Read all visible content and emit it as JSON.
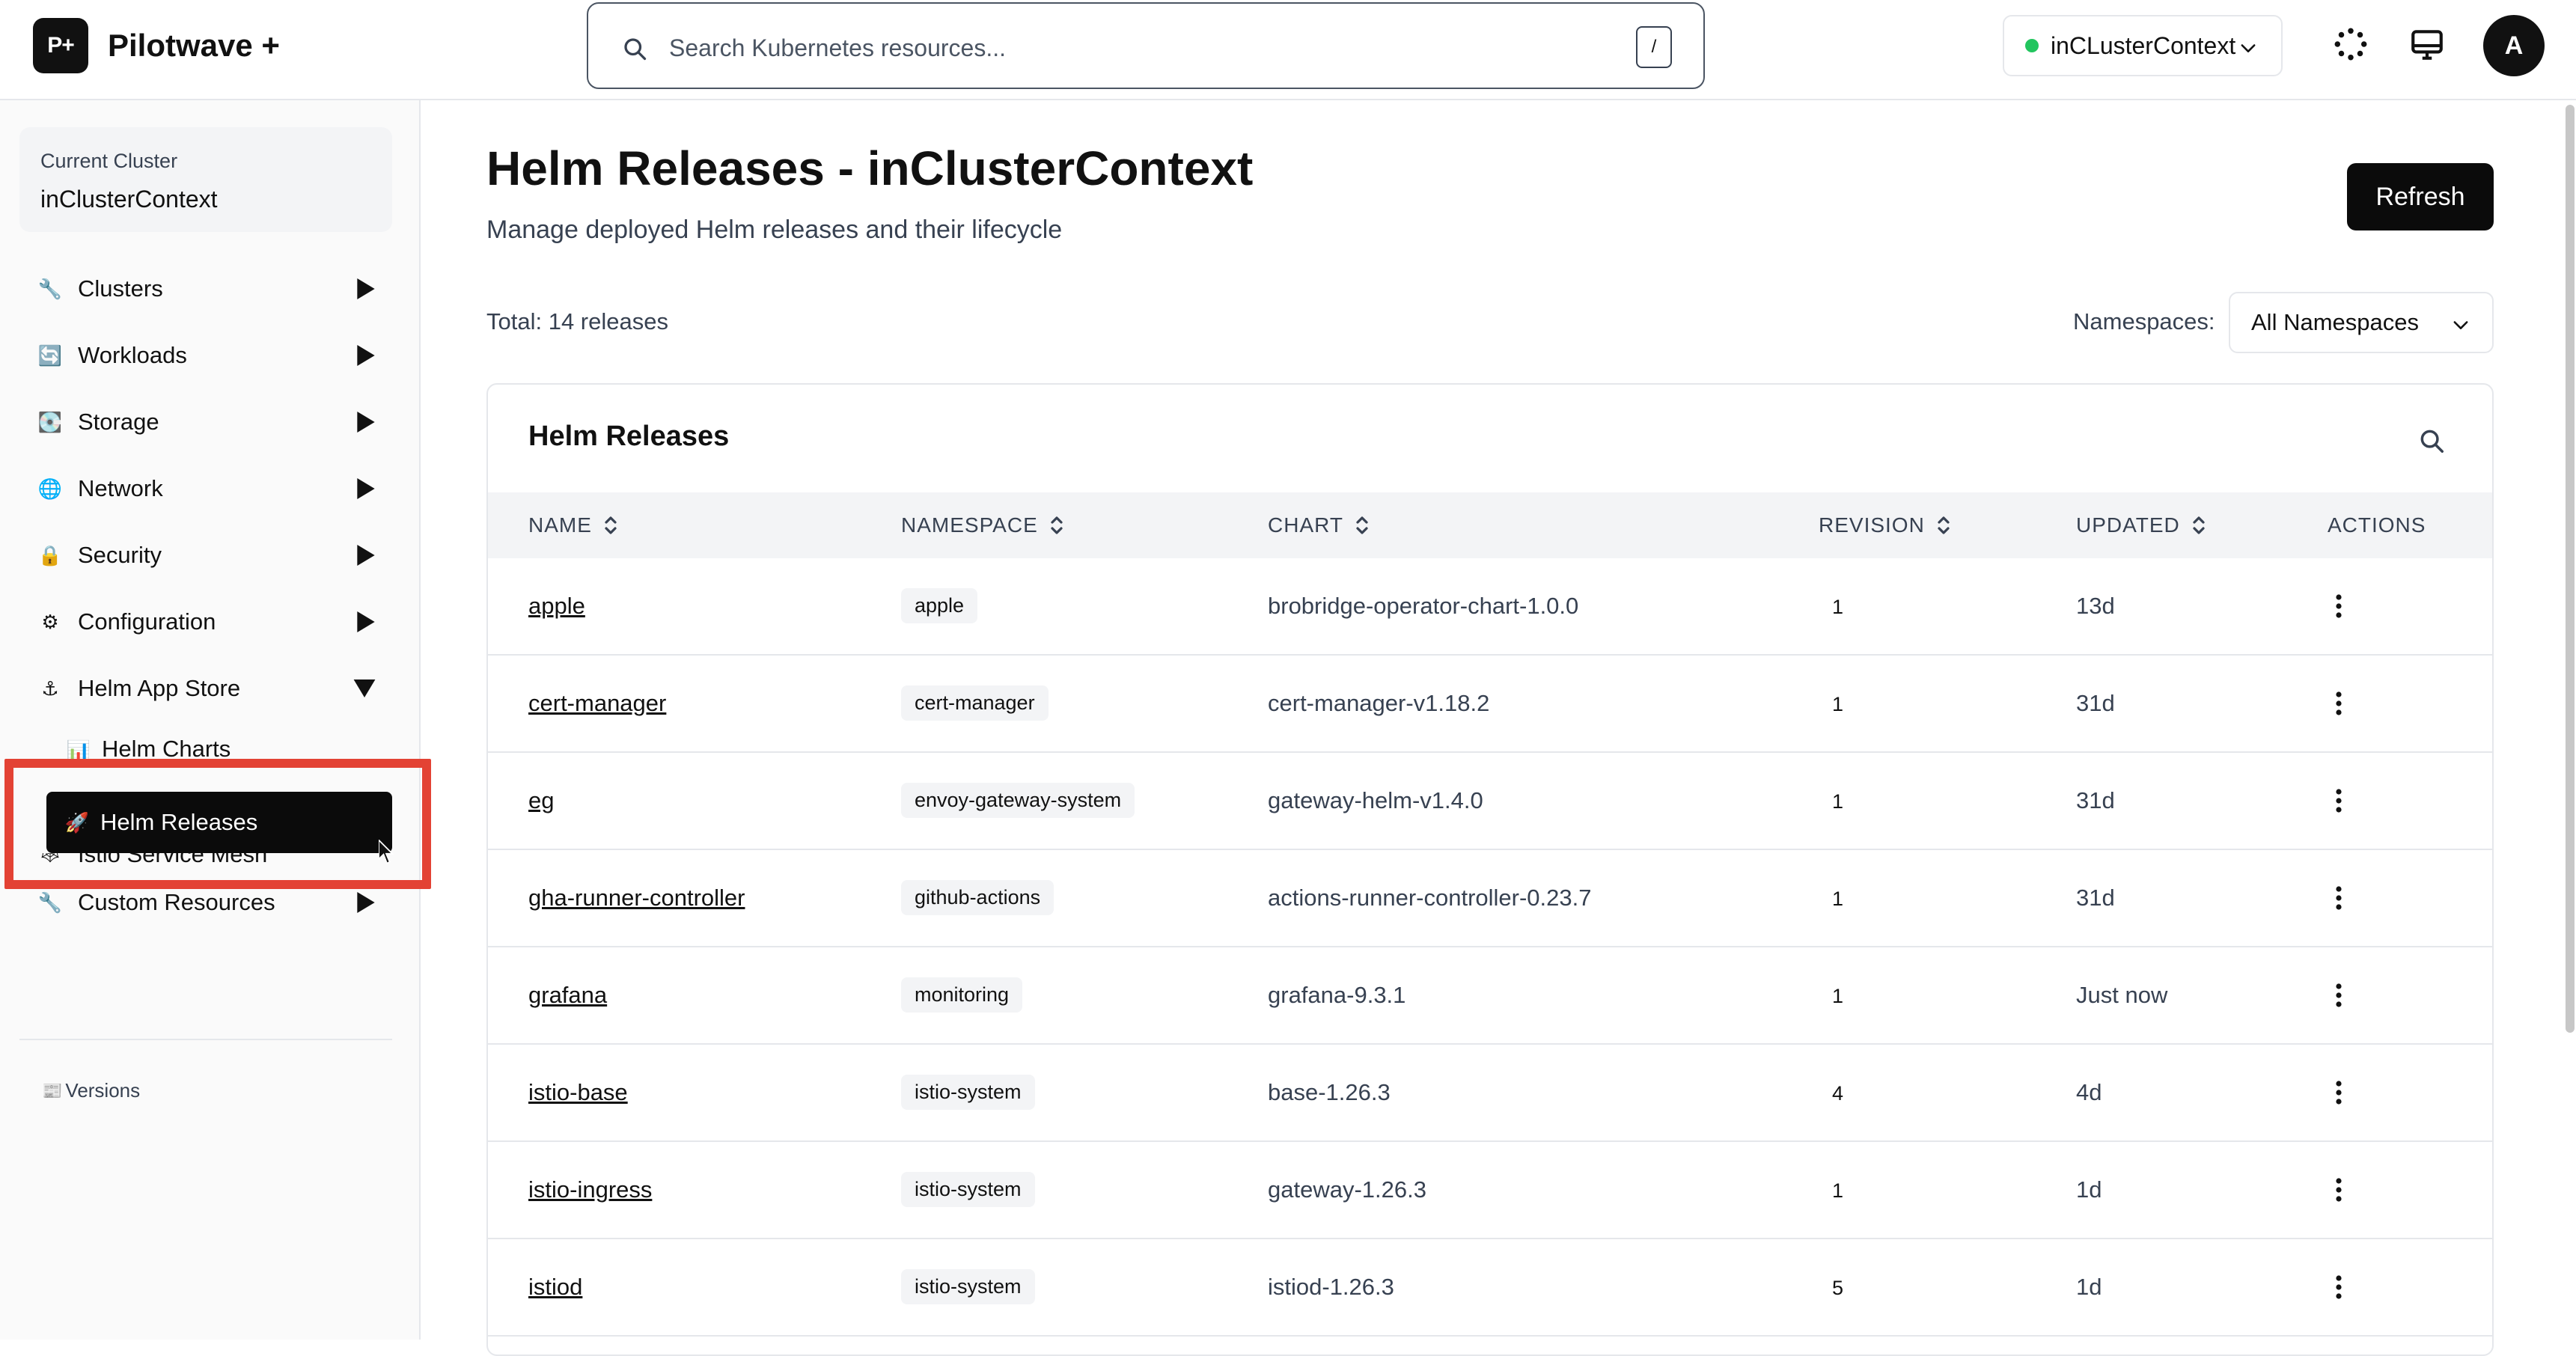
{
  "app": {
    "logo_text": "P+",
    "name": "Pilotwave +"
  },
  "search": {
    "placeholder": "Search Kubernetes resources...",
    "shortcut": "/"
  },
  "context": {
    "selected": "inCLusterContext",
    "status_color": "#22c55e"
  },
  "header_icons": [
    "loader-icon",
    "monitor-icon"
  ],
  "user": {
    "initial": "A"
  },
  "sidebar": {
    "current_cluster_label": "Current Cluster",
    "current_cluster_value": "inClusterContext",
    "items": [
      {
        "icon": "🔧",
        "label": "Clusters",
        "expanded": false
      },
      {
        "icon": "🔄",
        "label": "Workloads",
        "expanded": false
      },
      {
        "icon": "💽",
        "label": "Storage",
        "expanded": false
      },
      {
        "icon": "🌐",
        "label": "Network",
        "expanded": false
      },
      {
        "icon": "🔒",
        "label": "Security",
        "expanded": false
      },
      {
        "icon": "⚙",
        "label": "Configuration",
        "expanded": false
      },
      {
        "icon": "⚓",
        "label": "Helm App Store",
        "expanded": true
      },
      {
        "icon": "🕸",
        "label": "Istio Service Mesh",
        "expanded": false
      },
      {
        "icon": "🔧",
        "label": "Custom Resources",
        "expanded": false
      }
    ],
    "sub_items": [
      {
        "icon": "📊",
        "label": "Helm Charts"
      },
      {
        "icon": "🚀",
        "label": "Helm Releases",
        "active": true
      }
    ],
    "versions_icon": "📰",
    "versions_label": "Versions",
    "highlight_color": "#e34234"
  },
  "main": {
    "title": "Helm Releases - inClusterContext",
    "subtitle": "Manage deployed Helm releases and their lifecycle",
    "refresh_label": "Refresh",
    "total_text": "Total: 14 releases",
    "namespaces_label": "Namespaces:",
    "namespaces_selected": "All Namespaces"
  },
  "table": {
    "title": "Helm Releases",
    "columns": [
      "NAME",
      "NAMESPACE",
      "CHART",
      "REVISION",
      "UPDATED",
      "ACTIONS"
    ],
    "rows": [
      {
        "name": "apple",
        "namespace": "apple",
        "chart": "brobridge-operator-chart-1.0.0",
        "revision": "1",
        "updated": "13d"
      },
      {
        "name": "cert-manager",
        "namespace": "cert-manager",
        "chart": "cert-manager-v1.18.2",
        "revision": "1",
        "updated": "31d"
      },
      {
        "name": "eg",
        "namespace": "envoy-gateway-system",
        "chart": "gateway-helm-v1.4.0",
        "revision": "1",
        "updated": "31d"
      },
      {
        "name": "gha-runner-controller",
        "namespace": "github-actions",
        "chart": "actions-runner-controller-0.23.7",
        "revision": "1",
        "updated": "31d"
      },
      {
        "name": "grafana",
        "namespace": "monitoring",
        "chart": "grafana-9.3.1",
        "revision": "1",
        "updated": "Just now"
      },
      {
        "name": "istio-base",
        "namespace": "istio-system",
        "chart": "base-1.26.3",
        "revision": "4",
        "updated": "4d"
      },
      {
        "name": "istio-ingress",
        "namespace": "istio-system",
        "chart": "gateway-1.26.3",
        "revision": "1",
        "updated": "1d"
      },
      {
        "name": "istiod",
        "namespace": "istio-system",
        "chart": "istiod-1.26.3",
        "revision": "5",
        "updated": "1d"
      }
    ]
  }
}
